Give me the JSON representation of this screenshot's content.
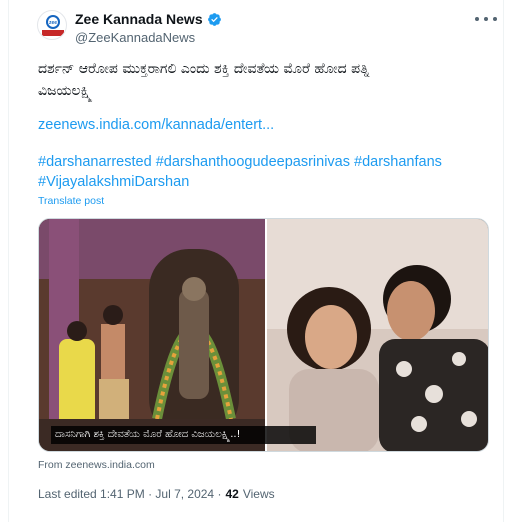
{
  "author": {
    "display_name": "Zee Kannada News",
    "handle": "@ZeeKannadaNews",
    "avatar_text": "ಕನ್ನಡ NEWS",
    "verified": true,
    "verified_color": "#1d9bf0"
  },
  "tweet": {
    "text_lines": [
      "ದರ್ಶನ್ ಆರೋಪ ಮುಕ್ತರಾಗಲಿ ಎಂದು  ಶಕ್ತಿ ದೇವತೆಯ ಮೊರೆ ಹೋದ ಪತ್ನಿ",
      "ವಿಜಯಲಕ್ಷ್ಮಿ"
    ],
    "link": "zeenews.india.com/kannada/entert...",
    "hashtags": [
      "#darshanarrested",
      "#darshanthoogudeepasrinivas",
      "#darshanfans",
      "#VijayalakshmiDarshan"
    ],
    "translate_label": "Translate post"
  },
  "media": {
    "caption": "ದಾಸನಿಗಾಗಿ ಶಕ್ತಿ ದೇವತೆಯ ಮೊರೆ ಹೋದ ವಿಜಯಲಕ್ಷ್ಮಿ..!",
    "source": "From zeenews.india.com"
  },
  "meta": {
    "edited": "Last edited 1:41 PM · Jul 7, 2024 ·",
    "views_count": "42",
    "views_label": "Views"
  },
  "colors": {
    "link": "#1d9bf0",
    "secondary": "#536471",
    "primary": "#0f1419"
  },
  "icons": [
    "verified-badge-icon",
    "more-options-icon"
  ]
}
